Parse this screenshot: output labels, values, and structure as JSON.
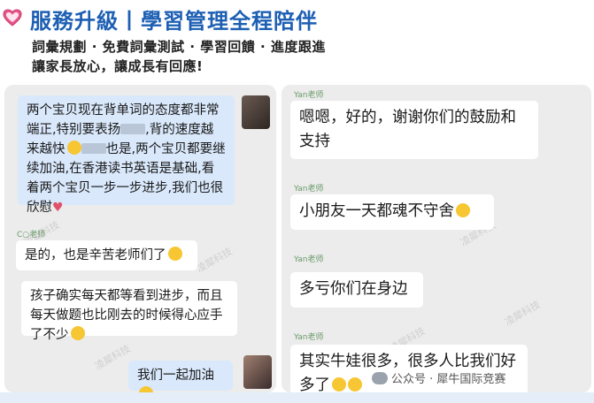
{
  "header": {
    "title": "服務升級丨學習管理全程陪伴",
    "subtitle_line1": "詞彙規劃 · 免費詞彙測試 · 學習回饋 · 進度跟進",
    "subtitle_line2": "讓家長放心，讓成長有回應!"
  },
  "left_chat": {
    "msg1_part1": "两个宝贝现在背单词的态度都非常端正,特别要表扬",
    "msg1_part2": ",背的速度越来越快",
    "msg1_part3": "也是,两个宝贝都要继续加油,在香港读书英语是基础,看着两个宝贝一步一步进步,我们也很欣慰",
    "sender_name": "C○老师",
    "msg2": "是的，也是辛苦老师们了",
    "msg3": "孩子确实每天都等看到进步，而且每天做题也比刚去的时候得心应手了不少",
    "msg4": "我们一起加油"
  },
  "right_chat": {
    "sender_name": "Yan老师",
    "msg1": "嗯嗯，好的，谢谢你们的鼓励和支持",
    "msg2": "小朋友一天都魂不守舍",
    "msg3": "多亏你们在身边",
    "msg4": "其实牛娃很多，很多人比我们好多了"
  },
  "watermark": "凌犀科技",
  "footer": {
    "text": "公众号 · 犀牛国际竞赛"
  },
  "colors": {
    "title": "#1d5fb3",
    "panel_bg": "#ececec",
    "bubble_blue": "#d9e8fb"
  }
}
